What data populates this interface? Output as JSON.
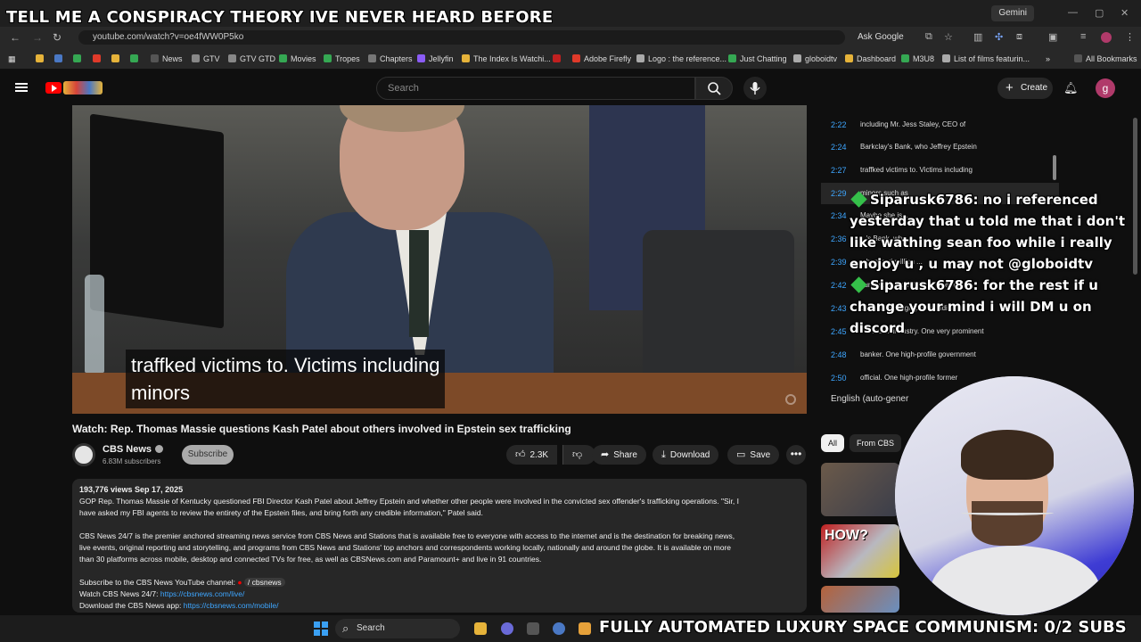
{
  "overlay": {
    "stream_title": "TELL ME A CONSPIRACY THEORY IVE NEVER HEARD BEFORE",
    "subs_goal": "FULLY AUTOMATED LUXURY SPACE COMMUNISM: 0/2 SUBS"
  },
  "browser": {
    "gemini_label": "Gemini",
    "url": "youtube.com/watch?v=oe4fWW0P5ko",
    "ask_google": "Ask Google",
    "all_bookmarks": "All Bookmarks",
    "bookmarks": [
      {
        "label": "News",
        "color": "#4a78c4"
      },
      {
        "label": "GTV",
        "color": "#888888"
      },
      {
        "label": "GTV GTD",
        "color": "#888888"
      },
      {
        "label": "Movies",
        "color": "#35a853"
      },
      {
        "label": "Tropes",
        "color": "#35a853"
      },
      {
        "label": "Chapters",
        "color": "#777777"
      },
      {
        "label": "Jellyfin",
        "color": "#8b5cf6"
      },
      {
        "label": "The Index Is Watchi...",
        "color": "#e6b33a"
      },
      {
        "label": "Adobe Firefly",
        "color": "#e03a2a"
      },
      {
        "label": "Logo : the reference...",
        "color": "#aaaaaa"
      },
      {
        "label": "Just Chatting",
        "color": "#35a853"
      },
      {
        "label": "globoidtv",
        "color": "#aaaaaa"
      },
      {
        "label": "Dashboard",
        "color": "#e6b33a"
      },
      {
        "label": "M3U8",
        "color": "#35a853"
      },
      {
        "label": "List of films featurin...",
        "color": "#aaaaaa"
      }
    ]
  },
  "youtube": {
    "search_placeholder": "Search",
    "create_label": "Create",
    "avatar_letter": "g",
    "captions": [
      "traffked victims to. Victims including",
      "minors"
    ],
    "video_title": "Watch: Rep. Thomas Massie questions Kash Patel about others involved in Epstein sex trafficking",
    "channel_name": "CBS News",
    "channel_subs": "6.83M subscribers",
    "subscribe_label": "Subscribe",
    "likes": "2.3K",
    "share_label": "Share",
    "download_label": "Download",
    "save_label": "Save",
    "description": {
      "meta": "193,776 views  Sep 17, 2025",
      "para1_line1": "GOP Rep. Thomas Massie of Kentucky questioned FBI Director Kash Patel about Jeffrey Epstein and whether other people were involved in the convicted sex offender's trafficking operations. \"Sir, I",
      "para1_line2": "have asked my FBI agents to review the entirety of the Epstein files, and bring forth any credible information,\" Patel said.",
      "para2_line1": "CBS News 24/7 is the premier anchored streaming news service from CBS News and Stations that is available free to everyone with access to the internet and is the destination for breaking news,",
      "para2_line2": "live events, original reporting and storytelling, and programs from CBS News and Stations' top anchors and correspondents working locally, nationally and around the globe. It is available on more",
      "para2_line3": "than 30 platforms across mobile, desktop and connected TVs for free, as well as CBSNews.com and Paramount+ and live in 91 countries.",
      "yt_channel_label": "Subscribe to the CBS News YouTube channel:",
      "yt_channel_link": "/ cbsnews",
      "watch_label": "Watch CBS News 24/7:",
      "watch_link": "https://cbsnews.com/live/",
      "app_label": "Download the CBS News app:",
      "app_link": "https://cbsnews.com/mobile/"
    },
    "transcript": [
      {
        "time": "2:22",
        "text": "including Mr. Jess Staley, CEO of"
      },
      {
        "time": "2:24",
        "text": "Barkclay's Bank, who Jeffrey Epstein"
      },
      {
        "time": "2:27",
        "text": "traffked victims to. Victims including"
      },
      {
        "time": "2:29",
        "text": "minors such as"
      },
      {
        "time": "2:34",
        "text": "Maybe she is..."
      },
      {
        "time": "2:36",
        "text": "...'s Bank, who ..."
      },
      {
        "time": "2:39",
        "text": "...hundred million ..."
      },
      {
        "time": "2:42",
        "text": "hundred million dollars. One royal"
      },
      {
        "time": "2:43",
        "text": "prince. One high-profile individual in"
      },
      {
        "time": "2:45",
        "text": "the music industry. One very prominent"
      },
      {
        "time": "2:48",
        "text": "banker. One high-profile government"
      },
      {
        "time": "2:50",
        "text": "official. One high-profile former"
      }
    ],
    "transcript_language": "English (auto-gener",
    "chips": {
      "all": "All",
      "from": "From CBS"
    },
    "rec2_badge": "HOW?"
  },
  "chat": [
    {
      "user": "Siparusk6786",
      "message": "no i referenced yesterday that u told me that i don't like wathing sean foo while i really enojoy u , u may not @globoidtv"
    },
    {
      "user": "Siparusk6786",
      "message": "for the rest if u change your mind i will DM u on discord"
    }
  ],
  "taskbar": {
    "search_label": "Search"
  }
}
